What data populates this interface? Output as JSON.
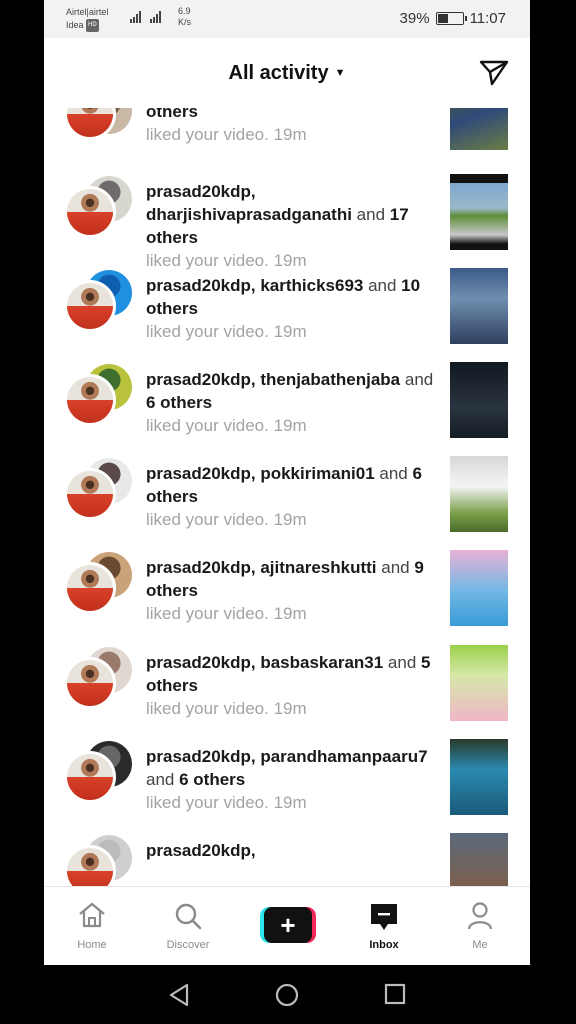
{
  "status_bar": {
    "carrier_line1": "Airtel|airtel",
    "carrier_line2": "Idea",
    "hd_badge": "HD",
    "speed_value": "6.9",
    "speed_unit": "K/s",
    "battery_percent": "39%",
    "battery_level": 0.39,
    "time": "11:07"
  },
  "header": {
    "title": "All activity",
    "send_icon": "paper-plane-icon"
  },
  "activity": [
    {
      "names": "",
      "and_text": "",
      "rest": "others",
      "meta": "liked your video. 19m"
    },
    {
      "names": "prasad20kdp, dharjishivaprasadganathi",
      "and_text": " and ",
      "rest": "17 others",
      "meta": "liked your video. 19m"
    },
    {
      "names": "prasad20kdp, karthicks693",
      "and_text": " and ",
      "rest": "10 others",
      "meta": "liked your video. 19m"
    },
    {
      "names": "prasad20kdp, thenjabathenjaba",
      "and_text": " and ",
      "rest": "6 others",
      "meta": "liked your video. 19m"
    },
    {
      "names": "prasad20kdp, pokkirimani01",
      "and_text": " and ",
      "rest": "6 others",
      "meta": "liked your video. 19m"
    },
    {
      "names": "prasad20kdp, ajitnareshkutti",
      "and_text": " and ",
      "rest": "9 others",
      "meta": "liked your video. 19m"
    },
    {
      "names": "prasad20kdp, basbaskaran31",
      "and_text": " and ",
      "rest": "5 others",
      "meta": "liked your video. 19m"
    },
    {
      "names": "prasad20kdp, parandhamanpaaru7",
      "and_text": " and ",
      "rest": "6 others",
      "meta": "liked your video. 19m"
    },
    {
      "names": "prasad20kdp,",
      "and_text": "",
      "rest": "",
      "meta": ""
    }
  ],
  "bottom_nav": {
    "home": "Home",
    "discover": "Discover",
    "inbox": "Inbox",
    "me": "Me"
  },
  "colors": {
    "accent_cyan": "#2ce5ed",
    "accent_pink": "#f4275a",
    "meta_gray": "#a3a3a3"
  }
}
